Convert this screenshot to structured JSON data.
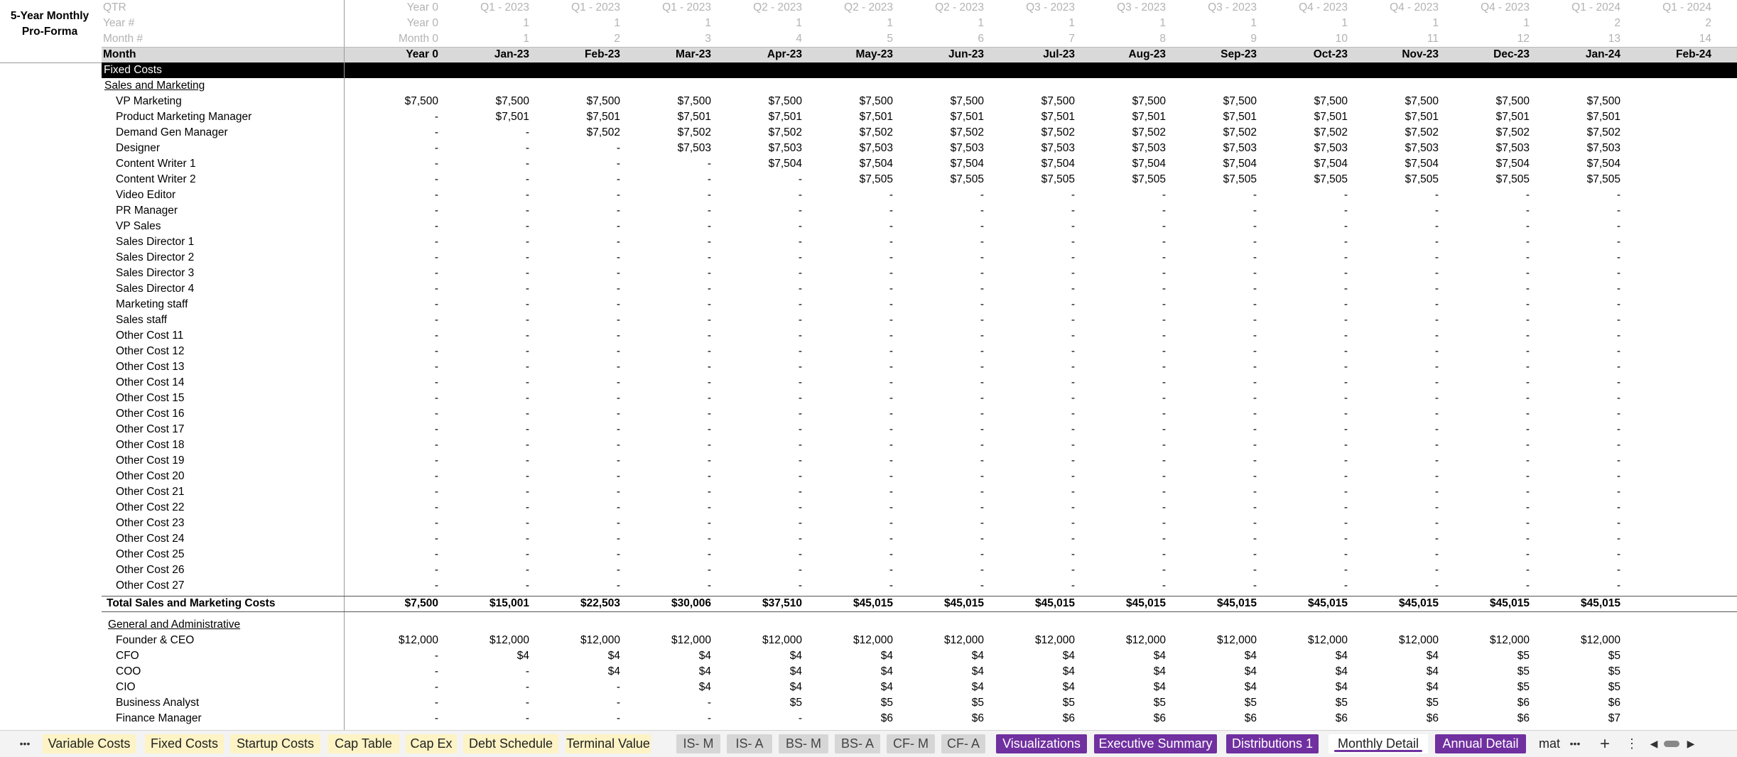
{
  "sheet_title_line1": "5-Year Monthly",
  "sheet_title_line2": "Pro-Forma",
  "header_labels": {
    "qtr": "QTR",
    "year": "Year #",
    "month_num": "Month #",
    "month": "Month"
  },
  "columns": [
    {
      "qtr": "Year 0",
      "year": "Year 0",
      "month_num": "Month 0",
      "month": "Year 0"
    },
    {
      "qtr": "Q1 - 2023",
      "year": "1",
      "month_num": "1",
      "month": "Jan-23"
    },
    {
      "qtr": "Q1 - 2023",
      "year": "1",
      "month_num": "2",
      "month": "Feb-23"
    },
    {
      "qtr": "Q1 - 2023",
      "year": "1",
      "month_num": "3",
      "month": "Mar-23"
    },
    {
      "qtr": "Q2 - 2023",
      "year": "1",
      "month_num": "4",
      "month": "Apr-23"
    },
    {
      "qtr": "Q2 - 2023",
      "year": "1",
      "month_num": "5",
      "month": "May-23"
    },
    {
      "qtr": "Q2 - 2023",
      "year": "1",
      "month_num": "6",
      "month": "Jun-23"
    },
    {
      "qtr": "Q3 - 2023",
      "year": "1",
      "month_num": "7",
      "month": "Jul-23"
    },
    {
      "qtr": "Q3 - 2023",
      "year": "1",
      "month_num": "8",
      "month": "Aug-23"
    },
    {
      "qtr": "Q3 - 2023",
      "year": "1",
      "month_num": "9",
      "month": "Sep-23"
    },
    {
      "qtr": "Q4 - 2023",
      "year": "1",
      "month_num": "10",
      "month": "Oct-23"
    },
    {
      "qtr": "Q4 - 2023",
      "year": "1",
      "month_num": "11",
      "month": "Nov-23"
    },
    {
      "qtr": "Q4 - 2023",
      "year": "1",
      "month_num": "12",
      "month": "Dec-23"
    },
    {
      "qtr": "Q1 - 2024",
      "year": "2",
      "month_num": "13",
      "month": "Jan-24"
    },
    {
      "qtr": "Q1 - 2024",
      "year": "2",
      "month_num": "14",
      "month": "Feb-24"
    }
  ],
  "fixed_costs_label": "Fixed Costs",
  "sales_section_label": "Sales and Marketing",
  "sales_rows": [
    {
      "label": "VP Marketing",
      "values": [
        "$7,500",
        "$7,500",
        "$7,500",
        "$7,500",
        "$7,500",
        "$7,500",
        "$7,500",
        "$7,500",
        "$7,500",
        "$7,500",
        "$7,500",
        "$7,500",
        "$7,500",
        "$7,500"
      ]
    },
    {
      "label": "Product Marketing Manager",
      "values": [
        "-",
        "$7,501",
        "$7,501",
        "$7,501",
        "$7,501",
        "$7,501",
        "$7,501",
        "$7,501",
        "$7,501",
        "$7,501",
        "$7,501",
        "$7,501",
        "$7,501",
        "$7,501"
      ]
    },
    {
      "label": "Demand Gen Manager",
      "values": [
        "-",
        "-",
        "$7,502",
        "$7,502",
        "$7,502",
        "$7,502",
        "$7,502",
        "$7,502",
        "$7,502",
        "$7,502",
        "$7,502",
        "$7,502",
        "$7,502",
        "$7,502"
      ]
    },
    {
      "label": "Designer",
      "values": [
        "-",
        "-",
        "-",
        "$7,503",
        "$7,503",
        "$7,503",
        "$7,503",
        "$7,503",
        "$7,503",
        "$7,503",
        "$7,503",
        "$7,503",
        "$7,503",
        "$7,503"
      ]
    },
    {
      "label": "Content Writer 1",
      "values": [
        "-",
        "-",
        "-",
        "-",
        "$7,504",
        "$7,504",
        "$7,504",
        "$7,504",
        "$7,504",
        "$7,504",
        "$7,504",
        "$7,504",
        "$7,504",
        "$7,504"
      ]
    },
    {
      "label": "Content Writer 2",
      "values": [
        "-",
        "-",
        "-",
        "-",
        "-",
        "$7,505",
        "$7,505",
        "$7,505",
        "$7,505",
        "$7,505",
        "$7,505",
        "$7,505",
        "$7,505",
        "$7,505"
      ]
    },
    {
      "label": "Video Editor",
      "values": [
        "-",
        "-",
        "-",
        "-",
        "-",
        "-",
        "-",
        "-",
        "-",
        "-",
        "-",
        "-",
        "-",
        "-"
      ]
    },
    {
      "label": "PR Manager",
      "values": [
        "-",
        "-",
        "-",
        "-",
        "-",
        "-",
        "-",
        "-",
        "-",
        "-",
        "-",
        "-",
        "-",
        "-"
      ]
    },
    {
      "label": "VP Sales",
      "values": [
        "-",
        "-",
        "-",
        "-",
        "-",
        "-",
        "-",
        "-",
        "-",
        "-",
        "-",
        "-",
        "-",
        "-"
      ]
    },
    {
      "label": "Sales Director 1",
      "values": [
        "-",
        "-",
        "-",
        "-",
        "-",
        "-",
        "-",
        "-",
        "-",
        "-",
        "-",
        "-",
        "-",
        "-"
      ]
    },
    {
      "label": "Sales Director 2",
      "values": [
        "-",
        "-",
        "-",
        "-",
        "-",
        "-",
        "-",
        "-",
        "-",
        "-",
        "-",
        "-",
        "-",
        "-"
      ]
    },
    {
      "label": "Sales Director 3",
      "values": [
        "-",
        "-",
        "-",
        "-",
        "-",
        "-",
        "-",
        "-",
        "-",
        "-",
        "-",
        "-",
        "-",
        "-"
      ]
    },
    {
      "label": "Sales Director 4",
      "values": [
        "-",
        "-",
        "-",
        "-",
        "-",
        "-",
        "-",
        "-",
        "-",
        "-",
        "-",
        "-",
        "-",
        "-"
      ]
    },
    {
      "label": "Marketing staff",
      "values": [
        "-",
        "-",
        "-",
        "-",
        "-",
        "-",
        "-",
        "-",
        "-",
        "-",
        "-",
        "-",
        "-",
        "-"
      ]
    },
    {
      "label": "Sales staff",
      "values": [
        "-",
        "-",
        "-",
        "-",
        "-",
        "-",
        "-",
        "-",
        "-",
        "-",
        "-",
        "-",
        "-",
        "-"
      ]
    },
    {
      "label": "Other Cost 11",
      "values": [
        "-",
        "-",
        "-",
        "-",
        "-",
        "-",
        "-",
        "-",
        "-",
        "-",
        "-",
        "-",
        "-",
        "-"
      ]
    },
    {
      "label": "Other Cost 12",
      "values": [
        "-",
        "-",
        "-",
        "-",
        "-",
        "-",
        "-",
        "-",
        "-",
        "-",
        "-",
        "-",
        "-",
        "-"
      ]
    },
    {
      "label": "Other Cost 13",
      "values": [
        "-",
        "-",
        "-",
        "-",
        "-",
        "-",
        "-",
        "-",
        "-",
        "-",
        "-",
        "-",
        "-",
        "-"
      ]
    },
    {
      "label": "Other Cost 14",
      "values": [
        "-",
        "-",
        "-",
        "-",
        "-",
        "-",
        "-",
        "-",
        "-",
        "-",
        "-",
        "-",
        "-",
        "-"
      ]
    },
    {
      "label": "Other Cost 15",
      "values": [
        "-",
        "-",
        "-",
        "-",
        "-",
        "-",
        "-",
        "-",
        "-",
        "-",
        "-",
        "-",
        "-",
        "-"
      ]
    },
    {
      "label": "Other Cost 16",
      "values": [
        "-",
        "-",
        "-",
        "-",
        "-",
        "-",
        "-",
        "-",
        "-",
        "-",
        "-",
        "-",
        "-",
        "-"
      ]
    },
    {
      "label": "Other Cost 17",
      "values": [
        "-",
        "-",
        "-",
        "-",
        "-",
        "-",
        "-",
        "-",
        "-",
        "-",
        "-",
        "-",
        "-",
        "-"
      ]
    },
    {
      "label": "Other Cost 18",
      "values": [
        "-",
        "-",
        "-",
        "-",
        "-",
        "-",
        "-",
        "-",
        "-",
        "-",
        "-",
        "-",
        "-",
        "-"
      ]
    },
    {
      "label": "Other Cost 19",
      "values": [
        "-",
        "-",
        "-",
        "-",
        "-",
        "-",
        "-",
        "-",
        "-",
        "-",
        "-",
        "-",
        "-",
        "-"
      ]
    },
    {
      "label": "Other Cost 20",
      "values": [
        "-",
        "-",
        "-",
        "-",
        "-",
        "-",
        "-",
        "-",
        "-",
        "-",
        "-",
        "-",
        "-",
        "-"
      ]
    },
    {
      "label": "Other Cost 21",
      "values": [
        "-",
        "-",
        "-",
        "-",
        "-",
        "-",
        "-",
        "-",
        "-",
        "-",
        "-",
        "-",
        "-",
        "-"
      ]
    },
    {
      "label": "Other Cost 22",
      "values": [
        "-",
        "-",
        "-",
        "-",
        "-",
        "-",
        "-",
        "-",
        "-",
        "-",
        "-",
        "-",
        "-",
        "-"
      ]
    },
    {
      "label": "Other Cost 23",
      "values": [
        "-",
        "-",
        "-",
        "-",
        "-",
        "-",
        "-",
        "-",
        "-",
        "-",
        "-",
        "-",
        "-",
        "-"
      ]
    },
    {
      "label": "Other Cost 24",
      "values": [
        "-",
        "-",
        "-",
        "-",
        "-",
        "-",
        "-",
        "-",
        "-",
        "-",
        "-",
        "-",
        "-",
        "-"
      ]
    },
    {
      "label": "Other Cost 25",
      "values": [
        "-",
        "-",
        "-",
        "-",
        "-",
        "-",
        "-",
        "-",
        "-",
        "-",
        "-",
        "-",
        "-",
        "-"
      ]
    },
    {
      "label": "Other Cost 26",
      "values": [
        "-",
        "-",
        "-",
        "-",
        "-",
        "-",
        "-",
        "-",
        "-",
        "-",
        "-",
        "-",
        "-",
        "-"
      ]
    },
    {
      "label": "Other Cost 27",
      "values": [
        "-",
        "-",
        "-",
        "-",
        "-",
        "-",
        "-",
        "-",
        "-",
        "-",
        "-",
        "-",
        "-",
        "-"
      ]
    }
  ],
  "sales_total": {
    "label": "Total Sales and Marketing Costs",
    "values": [
      "$7,500",
      "$15,001",
      "$22,503",
      "$30,006",
      "$37,510",
      "$45,015",
      "$45,015",
      "$45,015",
      "$45,015",
      "$45,015",
      "$45,015",
      "$45,015",
      "$45,015",
      "$45,015"
    ]
  },
  "ga_section_label": "General and Administrative",
  "ga_rows": [
    {
      "label": "Founder & CEO",
      "values": [
        "$12,000",
        "$12,000",
        "$12,000",
        "$12,000",
        "$12,000",
        "$12,000",
        "$12,000",
        "$12,000",
        "$12,000",
        "$12,000",
        "$12,000",
        "$12,000",
        "$12,000",
        "$12,000"
      ]
    },
    {
      "label": "CFO",
      "values": [
        "-",
        "$4",
        "$4",
        "$4",
        "$4",
        "$4",
        "$4",
        "$4",
        "$4",
        "$4",
        "$4",
        "$4",
        "$5",
        "$5"
      ]
    },
    {
      "label": "COO",
      "values": [
        "-",
        "-",
        "$4",
        "$4",
        "$4",
        "$4",
        "$4",
        "$4",
        "$4",
        "$4",
        "$4",
        "$4",
        "$5",
        "$5"
      ]
    },
    {
      "label": "CIO",
      "values": [
        "-",
        "-",
        "-",
        "$4",
        "$4",
        "$4",
        "$4",
        "$4",
        "$4",
        "$4",
        "$4",
        "$4",
        "$5",
        "$5"
      ]
    },
    {
      "label": "Business Analyst",
      "values": [
        "-",
        "-",
        "-",
        "-",
        "$5",
        "$5",
        "$5",
        "$5",
        "$5",
        "$5",
        "$5",
        "$5",
        "$6",
        "$6"
      ]
    },
    {
      "label": "Finance Manager",
      "values": [
        "-",
        "-",
        "-",
        "-",
        "-",
        "$6",
        "$6",
        "$6",
        "$6",
        "$6",
        "$6",
        "$6",
        "$6",
        "$7"
      ]
    }
  ],
  "tabs": [
    {
      "label": "Variable Costs",
      "style": "yellow"
    },
    {
      "label": "Fixed Costs",
      "style": "yellow"
    },
    {
      "label": "Startup Costs",
      "style": "yellow"
    },
    {
      "label": "Cap Table",
      "style": "yellow"
    },
    {
      "label": "Cap Ex",
      "style": "yellow"
    },
    {
      "label": "Debt Schedule",
      "style": "yellow"
    },
    {
      "label": "Terminal Value",
      "style": "yellow"
    },
    {
      "label": "IS- M",
      "style": "grey"
    },
    {
      "label": "IS- A",
      "style": "grey"
    },
    {
      "label": "BS- M",
      "style": "grey"
    },
    {
      "label": "BS- A",
      "style": "grey"
    },
    {
      "label": "CF- M",
      "style": "grey"
    },
    {
      "label": "CF- A",
      "style": "grey"
    },
    {
      "label": "Visualizations",
      "style": "purple"
    },
    {
      "label": "Executive Summary",
      "style": "purple"
    },
    {
      "label": "Distributions 1",
      "style": "purple"
    },
    {
      "label": "Monthly Detail",
      "style": "active"
    },
    {
      "label": "Annual Detail",
      "style": "purple"
    },
    {
      "label": "mat",
      "style": "plain"
    }
  ],
  "tab_controls": {
    "more_left": "•••",
    "more_right": "•••",
    "add": "+",
    "menu": "⋮",
    "scroll_left": "◀",
    "scroll_right": "▶"
  }
}
